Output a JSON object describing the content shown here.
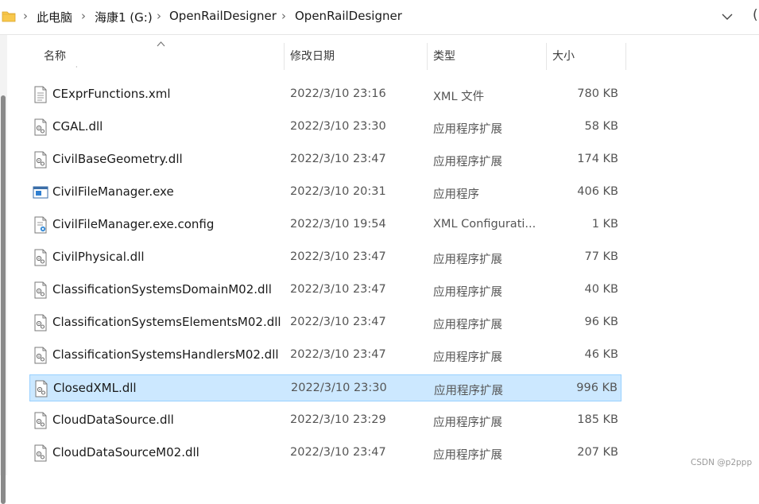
{
  "address": {
    "crumbs": [
      "此电脑",
      "海康1 (G:)",
      "OpenRailDesigner",
      "OpenRailDesigner"
    ],
    "separator": "›",
    "partial_button": "("
  },
  "columns": {
    "name": "名称",
    "date": "修改日期",
    "type": "类型",
    "size": "大小"
  },
  "files": [
    {
      "name": "CExprFunctions.xml",
      "date": "2022/3/10 23:16",
      "type": "XML 文件",
      "size": "780 KB",
      "icon": "xml-file-icon"
    },
    {
      "name": "CGAL.dll",
      "date": "2022/3/10 23:30",
      "type": "应用程序扩展",
      "size": "58 KB",
      "icon": "dll-file-icon"
    },
    {
      "name": "CivilBaseGeometry.dll",
      "date": "2022/3/10 23:47",
      "type": "应用程序扩展",
      "size": "174 KB",
      "icon": "dll-file-icon"
    },
    {
      "name": "CivilFileManager.exe",
      "date": "2022/3/10 20:31",
      "type": "应用程序",
      "size": "406 KB",
      "icon": "exe-file-icon"
    },
    {
      "name": "CivilFileManager.exe.config",
      "date": "2022/3/10 19:54",
      "type": "XML Configurati...",
      "size": "1 KB",
      "icon": "config-file-icon"
    },
    {
      "name": "CivilPhysical.dll",
      "date": "2022/3/10 23:47",
      "type": "应用程序扩展",
      "size": "77 KB",
      "icon": "dll-file-icon"
    },
    {
      "name": "ClassificationSystemsDomainM02.dll",
      "date": "2022/3/10 23:47",
      "type": "应用程序扩展",
      "size": "40 KB",
      "icon": "dll-file-icon"
    },
    {
      "name": "ClassificationSystemsElementsM02.dll",
      "date": "2022/3/10 23:47",
      "type": "应用程序扩展",
      "size": "96 KB",
      "icon": "dll-file-icon"
    },
    {
      "name": "ClassificationSystemsHandlersM02.dll",
      "date": "2022/3/10 23:47",
      "type": "应用程序扩展",
      "size": "46 KB",
      "icon": "dll-file-icon"
    },
    {
      "name": "ClosedXML.dll",
      "date": "2022/3/10 23:30",
      "type": "应用程序扩展",
      "size": "996 KB",
      "icon": "dll-file-icon",
      "selected": true
    },
    {
      "name": "CloudDataSource.dll",
      "date": "2022/3/10 23:29",
      "type": "应用程序扩展",
      "size": "185 KB",
      "icon": "dll-file-icon"
    },
    {
      "name": "CloudDataSourceM02.dll",
      "date": "2022/3/10 23:47",
      "type": "应用程序扩展",
      "size": "207 KB",
      "icon": "dll-file-icon"
    }
  ],
  "watermark": "CSDN @p2ppp",
  "colors": {
    "selected_bg": "#cce8ff",
    "selected_border": "#99d1ff",
    "folder": "#f8c84c"
  }
}
